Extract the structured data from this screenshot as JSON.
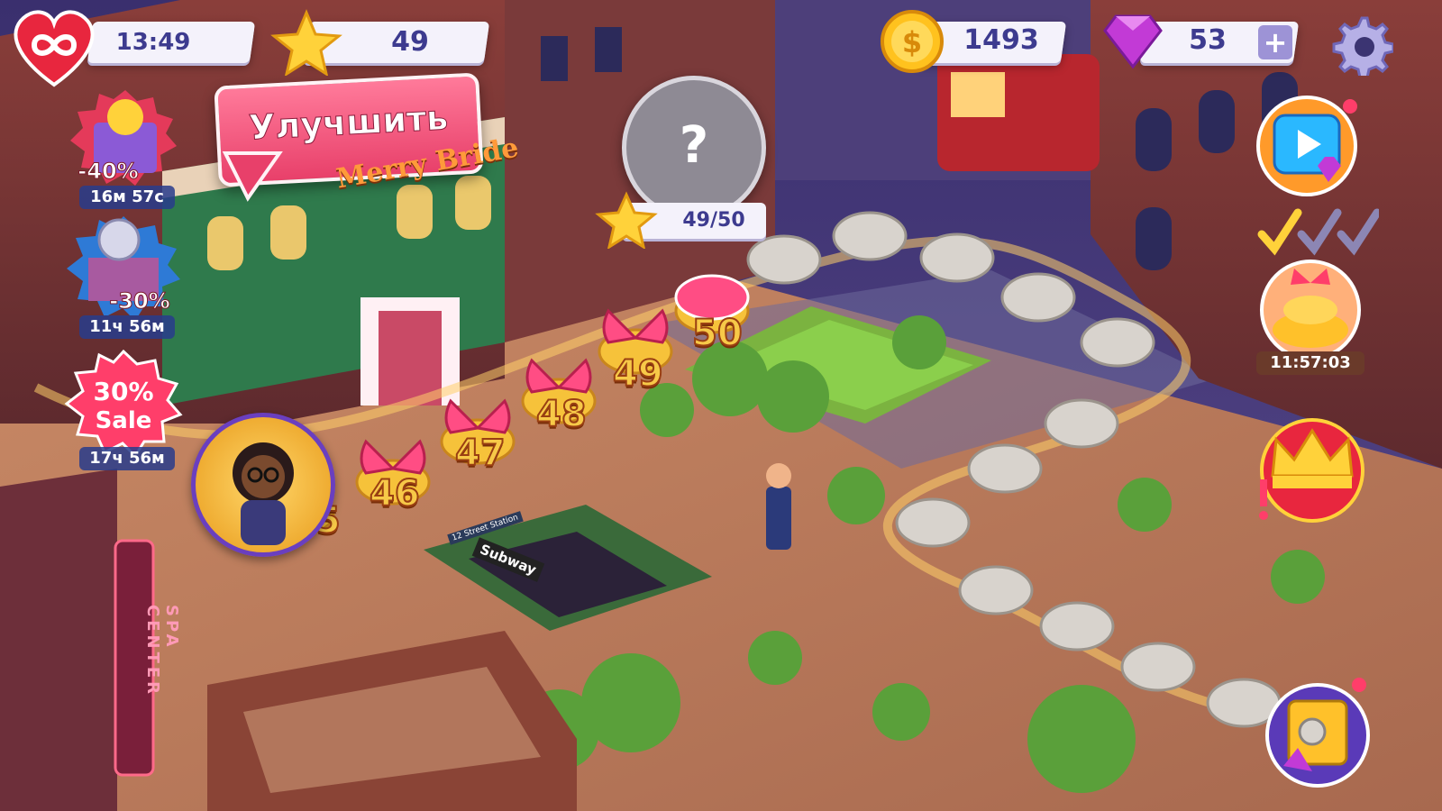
{
  "hud": {
    "lives": {
      "value": "13:49",
      "icon": "infinite-heart-icon"
    },
    "stars": {
      "value": "49",
      "icon": "star-icon"
    },
    "coins": {
      "value": "1493",
      "icon": "coin-icon"
    },
    "gems": {
      "value": "53",
      "icon": "gem-icon",
      "add_label": "+"
    },
    "settings_icon": "gear-icon"
  },
  "tooltip": {
    "text": "Улучшить"
  },
  "left_offers": [
    {
      "discount": "-40%",
      "timer": "16м 57с",
      "icon": "gift-bag-icon"
    },
    {
      "discount": "-30%",
      "timer": "11ч 56м",
      "icon": "disco-building-icon"
    },
    {
      "discount": "30%",
      "sale_label": "Sale",
      "timer": "17ч 56м",
      "icon": "sale-badge-icon"
    }
  ],
  "mystery": {
    "symbol": "?",
    "progress": "49/50"
  },
  "levels": [
    "45",
    "46",
    "47",
    "48",
    "49",
    "50"
  ],
  "right_panel": {
    "video_icon": "play-video-icon",
    "cake_timer": "11:57:03",
    "crown_icon": "crown-icon",
    "chest_icon": "treasure-safe-icon"
  },
  "scene_signs": {
    "boutique": "Merry Bride",
    "subway": "Subway",
    "spa": "SPA CENTER",
    "station": "12 Street Station"
  },
  "colors": {
    "accent": "#e8406a",
    "hud_text": "#3d3b8f",
    "gold": "#f7c948"
  }
}
